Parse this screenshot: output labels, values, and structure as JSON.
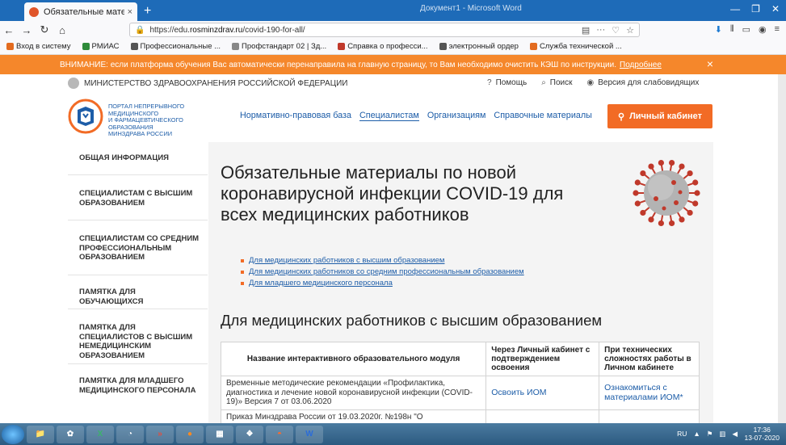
{
  "browser": {
    "tab_title": "Обязательные материалы по",
    "tab_close": "×",
    "new_tab": "+",
    "bg_window_title": "Документ1 - Microsoft Word",
    "url_host": "https://edu.",
    "url_domain": "rosminzdrav.ru",
    "url_path": "/covid-190-for-all/",
    "bookmarks": [
      {
        "label": "Вход в систему",
        "color": "#e36b1f"
      },
      {
        "label": "РМИАС",
        "color": "#2e8b3a"
      },
      {
        "label": "Профессиональные ...",
        "color": "#555555"
      },
      {
        "label": "Профстандарт 02 | Зд...",
        "color": "#888888"
      },
      {
        "label": "Справка о професси...",
        "color": "#c0392b"
      },
      {
        "label": "электронный ордер",
        "color": "#555555"
      },
      {
        "label": "Служба технической ...",
        "color": "#e36b1f"
      }
    ]
  },
  "alert": {
    "text": "ВНИМАНИЕ: если платформа обучения Вас автоматически перенаправила на главную страницу, то Вам необходимо очистить КЭШ по инструкции.",
    "link": "Подробнее",
    "close": "×"
  },
  "header": {
    "ministry": "МИНИСТЕРСТВО ЗДРАВООХРАНЕНИЯ РОССИЙСКОЙ ФЕДЕРАЦИИ",
    "help": "Помощь",
    "search": "Поиск",
    "accessible": "Версия для слабовидящих",
    "portal_line1": "ПОРТАЛ НЕПРЕРЫВНОГО",
    "portal_line2": "МЕДИЦИНСКОГО",
    "portal_line3": "И ФАРМАЦЕВТИЧЕСКОГО ОБРАЗОВАНИЯ",
    "portal_line4": "МИНЗДРАВА РОССИИ",
    "nav": [
      "Нормативно-правовая база",
      "Специалистам",
      "Организациям",
      "Справочные материалы"
    ],
    "cabinet": "Личный кабинет"
  },
  "sidebar": {
    "items": [
      "ОБЩАЯ ИНФОРМАЦИЯ",
      "СПЕЦИАЛИСТАМ С ВЫСШИМ ОБРАЗОВАНИЕМ",
      "СПЕЦИАЛИСТАМ СО СРЕДНИМ ПРОФЕССИОНАЛЬНЫМ ОБРАЗОВАНИЕМ",
      "ПАМЯТКА ДЛЯ ОБУЧАЮЩИХСЯ",
      "ПАМЯТКА ДЛЯ СПЕЦИАЛИСТОВ С ВЫСШИМ НЕМЕДИЦИНСКИМ ОБРАЗОВАНИЕМ",
      "ПАМЯТКА ДЛЯ МЛАДШЕГО МЕДИЦИНСКОГО ПЕРСОНАЛА"
    ]
  },
  "main": {
    "title": "Обязательные материалы по новой коронавирусной инфекции COVID-19 для всех медицинских работников",
    "links": [
      "Для медицинских работников с высшим образованием",
      "Для медицинских работников со средним профессиональным образованием",
      "Для младшего медицинского персонала"
    ],
    "section_title": "Для медицинских работников с высшим образованием",
    "table": {
      "headers": [
        "Название интерактивного образовательного модуля",
        "Через Личный кабинет с подтверждением освоения",
        "При технических сложностях работы в Личном кабинете"
      ],
      "rows": [
        {
          "name": "Временные методические рекомендации «Профилактика, диагностика и лечение новой коронавирусной инфекции (COVID-19)» Версия 7 от 03.06.2020",
          "via_cabinet": "Освоить ИОМ",
          "fallback": "Ознакомиться с материалами ИОМ*"
        },
        {
          "name": "Приказ Минздрава России от 19.03.2020г. №198н \"О",
          "via_cabinet": "",
          "fallback": ""
        }
      ]
    }
  },
  "taskbar": {
    "lang": "RU",
    "time": "17:36",
    "date": "13-07-2020"
  }
}
